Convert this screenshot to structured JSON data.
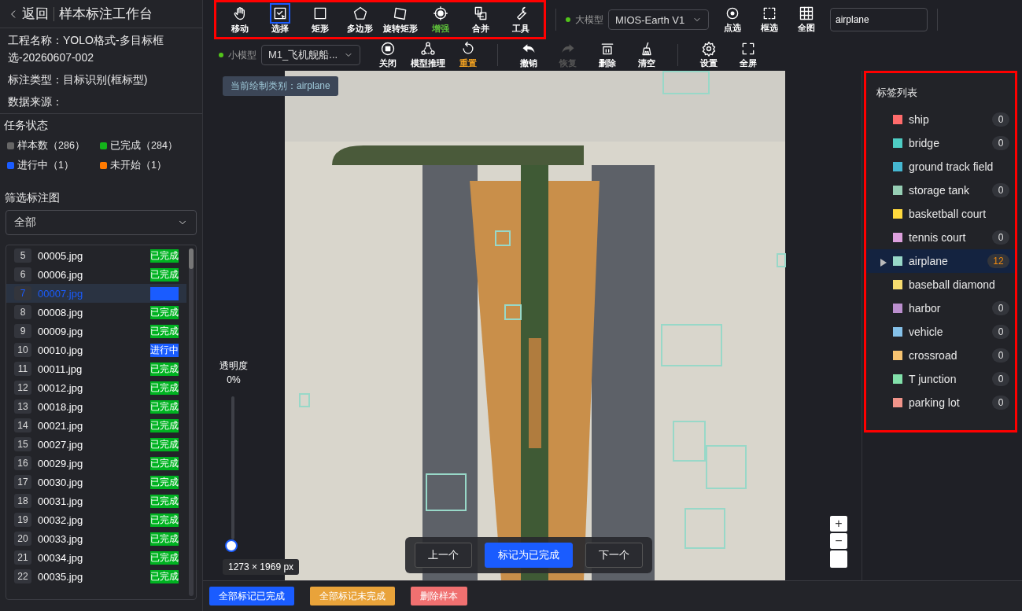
{
  "sidebar": {
    "back": "返回",
    "title": "样本标注工作台",
    "project": "工程名称：YOLO格式-多目标框选-20260607-002",
    "annotation_type": "标注类型：目标识别(框标型)",
    "data_source": "数据来源：",
    "task_status": {
      "title": "任务状态",
      "items": [
        {
          "label": "样本数（286）",
          "color": "#666666"
        },
        {
          "label": "已完成（284）",
          "color": "#13b31a"
        },
        {
          "label": "进行中（1）",
          "color": "#1a5cff"
        },
        {
          "label": "未开始（1）",
          "color": "#ff7a00"
        }
      ]
    },
    "filter": {
      "title": "筛选标注图",
      "value": "全部"
    },
    "files": [
      {
        "index": "5",
        "name": "00005.jpg",
        "status": "已完成",
        "kind": "done",
        "selected": false
      },
      {
        "index": "6",
        "name": "00006.jpg",
        "status": "已完成",
        "kind": "done",
        "selected": false
      },
      {
        "index": "7",
        "name": "00007.jpg",
        "kind": "blank",
        "selected": true
      },
      {
        "index": "8",
        "name": "00008.jpg",
        "status": "已完成",
        "kind": "done",
        "selected": false
      },
      {
        "index": "9",
        "name": "00009.jpg",
        "status": "已完成",
        "kind": "done",
        "selected": false
      },
      {
        "index": "10",
        "name": "00010.jpg",
        "status": "进行中",
        "kind": "progress",
        "selected": false
      },
      {
        "index": "11",
        "name": "00011.jpg",
        "status": "已完成",
        "kind": "done",
        "selected": false
      },
      {
        "index": "12",
        "name": "00012.jpg",
        "status": "已完成",
        "kind": "done",
        "selected": false
      },
      {
        "index": "13",
        "name": "00018.jpg",
        "status": "已完成",
        "kind": "done",
        "selected": false
      },
      {
        "index": "14",
        "name": "00021.jpg",
        "status": "已完成",
        "kind": "done",
        "selected": false
      },
      {
        "index": "15",
        "name": "00027.jpg",
        "status": "已完成",
        "kind": "done",
        "selected": false
      },
      {
        "index": "16",
        "name": "00029.jpg",
        "status": "已完成",
        "kind": "done",
        "selected": false
      },
      {
        "index": "17",
        "name": "00030.jpg",
        "status": "已完成",
        "kind": "done",
        "selected": false
      },
      {
        "index": "18",
        "name": "00031.jpg",
        "status": "已完成",
        "kind": "done",
        "selected": false
      },
      {
        "index": "19",
        "name": "00032.jpg",
        "status": "已完成",
        "kind": "done",
        "selected": false
      },
      {
        "index": "20",
        "name": "00033.jpg",
        "status": "已完成",
        "kind": "done",
        "selected": false
      },
      {
        "index": "21",
        "name": "00034.jpg",
        "status": "已完成",
        "kind": "done",
        "selected": false
      },
      {
        "index": "22",
        "name": "00035.jpg",
        "status": "已完成",
        "kind": "done",
        "selected": false
      }
    ]
  },
  "toolbar": {
    "tools": [
      {
        "label": "移动",
        "selected": false,
        "highlighted": false
      },
      {
        "label": "选择",
        "selected": true,
        "highlighted": false
      },
      {
        "label": "矩形",
        "selected": false,
        "highlighted": false
      },
      {
        "label": "多边形",
        "selected": false,
        "highlighted": false
      },
      {
        "label": "旋转矩形",
        "selected": false,
        "highlighted": false
      },
      {
        "label": "增强",
        "selected": false,
        "highlighted": true
      },
      {
        "label": "合并",
        "selected": false,
        "highlighted": false
      },
      {
        "label": "工具",
        "selected": false,
        "highlighted": false
      }
    ],
    "large_model": {
      "label": "大模型",
      "value": "MIOS-Earth V1"
    },
    "large_actions": [
      {
        "label": "点选"
      },
      {
        "label": "框选"
      },
      {
        "label": "全图"
      }
    ],
    "prompt_field": {
      "value": "airplane"
    },
    "small_model": {
      "label": "小模型",
      "value": "M1_飞机舰船..."
    },
    "actions": [
      {
        "label": "关闭",
        "disabled": false,
        "highlighted": false
      },
      {
        "label": "模型推理",
        "disabled": false,
        "highlighted": false
      },
      {
        "label": "重置",
        "disabled": false,
        "highlighted": true
      },
      {
        "label": "撤销",
        "disabled": false,
        "highlighted": false
      },
      {
        "label": "恢复",
        "disabled": true,
        "highlighted": false
      },
      {
        "label": "删除",
        "disabled": false,
        "highlighted": false
      },
      {
        "label": "清空",
        "disabled": false,
        "highlighted": false
      },
      {
        "label": "设置",
        "disabled": false,
        "highlighted": false
      },
      {
        "label": "全屏",
        "disabled": false,
        "highlighted": false
      }
    ]
  },
  "canvas": {
    "current_category": "当前绘制类别：airplane",
    "opacity": {
      "label": "透明度",
      "reading": "0%",
      "level": 0
    },
    "image_size": "1273 × 1969 px",
    "nav": [
      {
        "label": "上一个",
        "kind": "secondary"
      },
      {
        "label": "标记为已完成",
        "kind": "primary"
      },
      {
        "label": "下一个",
        "kind": "secondary"
      }
    ],
    "zoom": [
      "+",
      "−"
    ]
  },
  "labels": {
    "title": "标签列表",
    "items": [
      {
        "name": "ship",
        "color": "#ff6b6b",
        "count": "0",
        "selected": false
      },
      {
        "name": "bridge",
        "color": "#4ecdc4",
        "count": "0",
        "selected": false
      },
      {
        "name": "ground track field",
        "color": "#45b7d1",
        "selected": false
      },
      {
        "name": "storage tank",
        "color": "#96ceb4",
        "count": "0",
        "selected": false
      },
      {
        "name": "basketball court",
        "color": "#ffd93d",
        "selected": false
      },
      {
        "name": "tennis court",
        "color": "#dda0dd",
        "count": "0",
        "selected": false
      },
      {
        "name": "airplane",
        "color": "#98d8c8",
        "count": "12",
        "selected": true
      },
      {
        "name": "baseball diamond",
        "color": "#f7dc6f",
        "selected": false
      },
      {
        "name": "harbor",
        "color": "#bb8fce",
        "count": "0",
        "selected": false
      },
      {
        "name": "vehicle",
        "color": "#85c1e9",
        "count": "0",
        "selected": false
      },
      {
        "name": "crossroad",
        "color": "#f8c471",
        "count": "0",
        "selected": false
      },
      {
        "name": "T junction",
        "color": "#82e0aa",
        "count": "0",
        "selected": false
      },
      {
        "name": "parking lot",
        "color": "#f1948a",
        "count": "0",
        "selected": false
      }
    ]
  },
  "bottom_bar": [
    {
      "label": "全部标记已完成",
      "kind": "blue"
    },
    {
      "label": "全部标记未完成",
      "kind": "orange"
    },
    {
      "label": "删除样本",
      "kind": "red"
    }
  ]
}
